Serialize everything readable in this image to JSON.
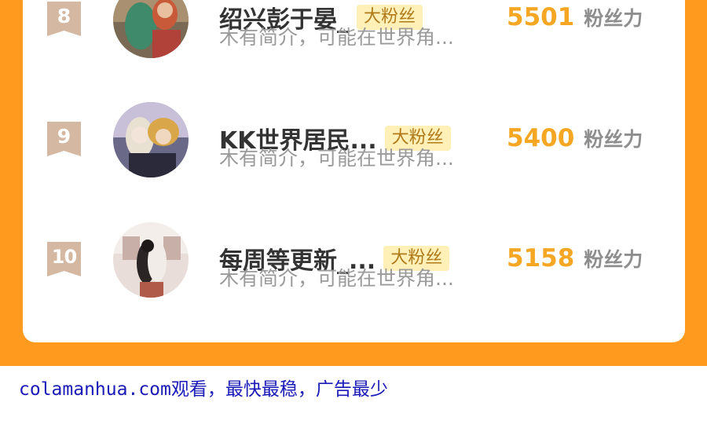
{
  "ranking": {
    "rows": [
      {
        "rank": "8",
        "name": "绍兴彭于晏_",
        "badge": "大粉丝",
        "intro": "木有简介，可能在世界角...",
        "score": "5501",
        "score_unit": "粉丝力"
      },
      {
        "rank": "9",
        "name": "KK世界居民...",
        "badge": "大粉丝",
        "intro": "木有简介，可能在世界角...",
        "score": "5400",
        "score_unit": "粉丝力"
      },
      {
        "rank": "10",
        "name": "每周等更新_...",
        "badge": "大粉丝",
        "intro": "木有简介，可能在世界角...",
        "score": "5158",
        "score_unit": "粉丝力"
      }
    ]
  },
  "footer": {
    "text": "colamanhua.com观看，最快最稳，广告最少"
  },
  "colors": {
    "background": "#ff9a1f",
    "card": "#ffffff",
    "rank_badge": "#d4b8a2",
    "score": "#f5a623",
    "footer_text": "#1a1ab8"
  }
}
